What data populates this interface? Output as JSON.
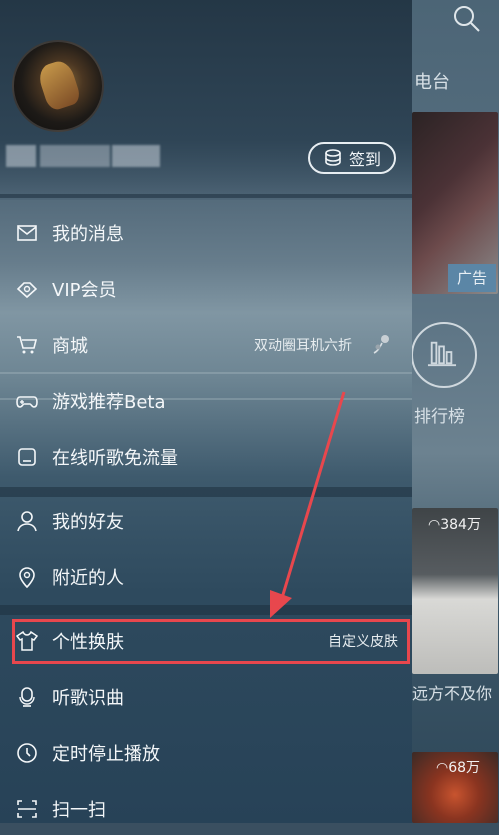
{
  "background": {
    "tab_partial": "电台",
    "ad_badge": "广告",
    "ranking_label": "排行榜",
    "play_count_1": "384万",
    "song_partial": "远方不及你",
    "play_count_2": "68万"
  },
  "drawer": {
    "signin_label": "签到",
    "menu": [
      {
        "label": "我的消息",
        "extra": ""
      },
      {
        "label": "VIP会员",
        "extra": ""
      },
      {
        "label": "商城",
        "extra": "双动圈耳机六折"
      },
      {
        "label": "游戏推荐Beta",
        "extra": ""
      },
      {
        "label": "在线听歌免流量",
        "extra": ""
      },
      {
        "label": "我的好友",
        "extra": ""
      },
      {
        "label": "附近的人",
        "extra": ""
      },
      {
        "label": "个性换肤",
        "extra": "自定义皮肤"
      },
      {
        "label": "听歌识曲",
        "extra": ""
      },
      {
        "label": "定时停止播放",
        "extra": ""
      },
      {
        "label": "扫一扫",
        "extra": ""
      }
    ]
  },
  "colors": {
    "highlight": "#e8474d",
    "accent": "#5b86a6"
  }
}
